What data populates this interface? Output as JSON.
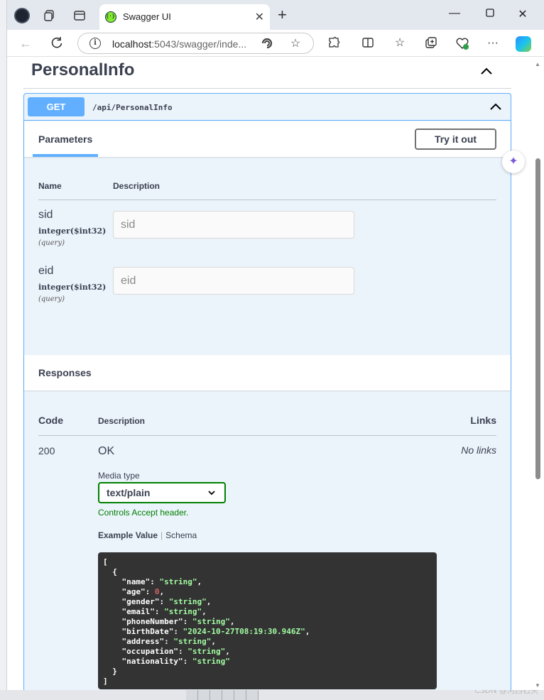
{
  "browser": {
    "tab_title": "Swagger UI",
    "url_host": "localhost",
    "url_rest": ":5043/swagger/inde...",
    "icons": [
      "profile-icon",
      "collections-icon",
      "tab-actions-icon",
      "swagger-favicon",
      "close-icon",
      "new-tab-icon",
      "minimize-icon",
      "maximize-icon",
      "close-window-icon",
      "back-icon",
      "refresh-icon",
      "site-info-icon",
      "read-aloud-icon",
      "favorite-icon",
      "extensions-icon",
      "split-screen-icon",
      "favorites-icon",
      "collections-icon",
      "browser-essentials-icon",
      "more-icon",
      "copilot-icon"
    ]
  },
  "swagger": {
    "tag_title": "PersonalInfo",
    "method": "GET",
    "path": "/api/PersonalInfo",
    "parameters_tab": "Parameters",
    "try_button": "Try it out",
    "param_col_name": "Name",
    "param_col_desc": "Description",
    "parameters": [
      {
        "name": "sid",
        "type": "integer($int32)",
        "in": "(query)",
        "placeholder": "sid"
      },
      {
        "name": "eid",
        "type": "integer($int32)",
        "in": "(query)",
        "placeholder": "eid"
      }
    ],
    "responses_title": "Responses",
    "resp_col_code": "Code",
    "resp_col_desc": "Description",
    "resp_col_links": "Links",
    "response": {
      "code": "200",
      "description": "OK",
      "links": "No links",
      "media_label": "Media type",
      "media_value": "text/plain",
      "accept_note": "Controls Accept header.",
      "example_tab": "Example Value",
      "schema_tab": "Schema"
    },
    "example": [
      {
        "key": "name",
        "value": "\"string\"",
        "kind": "str"
      },
      {
        "key": "age",
        "value": "0",
        "kind": "num"
      },
      {
        "key": "gender",
        "value": "\"string\"",
        "kind": "str"
      },
      {
        "key": "email",
        "value": "\"string\"",
        "kind": "str"
      },
      {
        "key": "phoneNumber",
        "value": "\"string\"",
        "kind": "str"
      },
      {
        "key": "birthDate",
        "value": "\"2024-10-27T08:19:30.946Z\"",
        "kind": "str"
      },
      {
        "key": "address",
        "value": "\"string\"",
        "kind": "str"
      },
      {
        "key": "occupation",
        "value": "\"string\"",
        "kind": "str"
      },
      {
        "key": "nationality",
        "value": "\"string\"",
        "kind": "str"
      }
    ]
  },
  "background": {
    "watermark": "CSDN @河西石头"
  },
  "colors": {
    "get_method": "#61affe",
    "opblock_bg": "#ebf3fb",
    "code_bg": "#333333",
    "code_string": "#a2fca2",
    "code_number": "#d36363",
    "accept_green": "#008000"
  }
}
